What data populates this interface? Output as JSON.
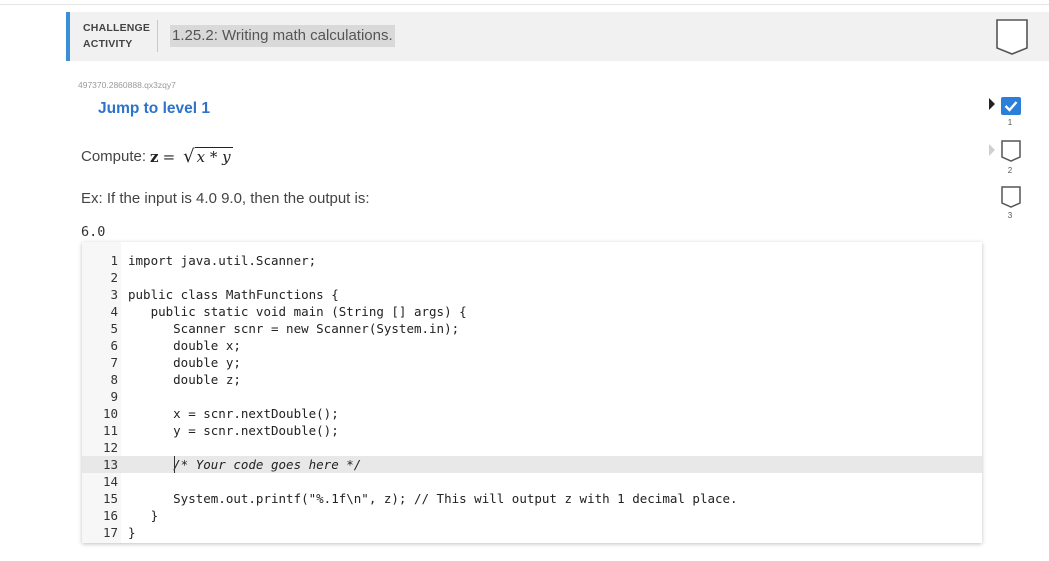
{
  "header": {
    "label_line1": "CHALLENGE",
    "label_line2": "ACTIVITY",
    "title": "1.25.2: Writing math calculations."
  },
  "activity_id": "497370.2860888.qx3zqy7",
  "jump_link": "Jump to level 1",
  "prompt": {
    "lead": "Compute:",
    "var": "z",
    "equals": "=",
    "radicand": "x * y"
  },
  "example": "Ex: If the input is 4.0 9.0, then the output is:",
  "output": "6.0",
  "code": {
    "lines": [
      {
        "n": "1",
        "text": "import java.util.Scanner;"
      },
      {
        "n": "2",
        "text": ""
      },
      {
        "n": "3",
        "text": "public class MathFunctions {"
      },
      {
        "n": "4",
        "text": "   public static void main (String [] args) {"
      },
      {
        "n": "5",
        "text": "      Scanner scnr = new Scanner(System.in);"
      },
      {
        "n": "6",
        "text": "      double x;"
      },
      {
        "n": "7",
        "text": "      double y;"
      },
      {
        "n": "8",
        "text": "      double z;"
      },
      {
        "n": "9",
        "text": ""
      },
      {
        "n": "10",
        "text": "      x = scnr.nextDouble();"
      },
      {
        "n": "11",
        "text": "      y = scnr.nextDouble();"
      },
      {
        "n": "12",
        "text": ""
      },
      {
        "n": "13",
        "text": "      /* Your code goes here */"
      },
      {
        "n": "14",
        "text": ""
      },
      {
        "n": "15",
        "text": "      System.out.printf(\"%.1f\\n\", z); // This will output z with 1 decimal place."
      },
      {
        "n": "16",
        "text": "   }"
      },
      {
        "n": "17",
        "text": "}"
      }
    ]
  },
  "levels": [
    {
      "num": "1",
      "state": "completed"
    },
    {
      "num": "2",
      "state": "empty"
    },
    {
      "num": "3",
      "state": "empty"
    }
  ],
  "colors": {
    "accent": "#3a8fd6",
    "link": "#2c73c9",
    "check": "#2b7fd8"
  }
}
